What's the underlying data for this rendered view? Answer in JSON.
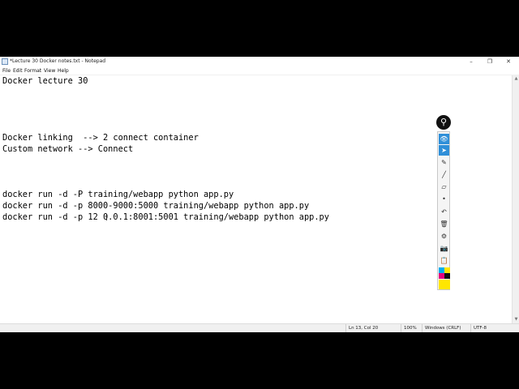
{
  "window": {
    "title": "*Lecture 30 Docker notes.txt - Notepad",
    "minimize_glyph": "–",
    "maximize_glyph": "❐",
    "close_glyph": "✕"
  },
  "menu": {
    "file": "File",
    "edit": "Edit",
    "format": "Format",
    "view": "View",
    "help": "Help"
  },
  "editor": {
    "lines": [
      "Docker lecture 30",
      "",
      "",
      "",
      "",
      "Docker linking  --> 2 connect container",
      "Custom network --> Connect",
      "",
      "",
      "",
      "docker run -d -P training/webapp python app.py",
      "docker run -d -p 8000-9000:5000 training/webapp python app.py",
      "docker run -d -p 12 0.0.1:8001:5001 training/webapp python app.py"
    ],
    "caret_glyph": "I"
  },
  "status": {
    "position": "Ln 13, Col 20",
    "zoom": "100%",
    "line_ending": "Windows (CRLF)",
    "encoding": "UTF-8"
  },
  "toolbar": {
    "logo_glyph": "⚲",
    "tools": [
      {
        "name": "eye-icon",
        "glyph": "👁",
        "active": true
      },
      {
        "name": "cursor-icon",
        "glyph": "➤",
        "active": true
      },
      {
        "name": "pen-icon",
        "glyph": "✎",
        "active": false
      },
      {
        "name": "marker-icon",
        "glyph": "╱",
        "active": false
      },
      {
        "name": "eraser-icon",
        "glyph": "▱",
        "active": false
      },
      {
        "name": "dot-icon",
        "glyph": "•",
        "active": false
      },
      {
        "name": "undo-icon",
        "glyph": "↶",
        "active": false
      },
      {
        "name": "trash-icon",
        "glyph": "🗑",
        "active": false
      },
      {
        "name": "settings-icon",
        "glyph": "⚙",
        "active": false
      },
      {
        "name": "camera-icon",
        "glyph": "📷",
        "active": false
      },
      {
        "name": "clipboard-icon",
        "glyph": "📋",
        "active": false
      }
    ],
    "colors": [
      "#00aeef",
      "#ffe600",
      "#e6007e",
      "#111111",
      "#ffe600"
    ]
  },
  "scrollbar": {
    "up_glyph": "▲",
    "down_glyph": "▼"
  }
}
